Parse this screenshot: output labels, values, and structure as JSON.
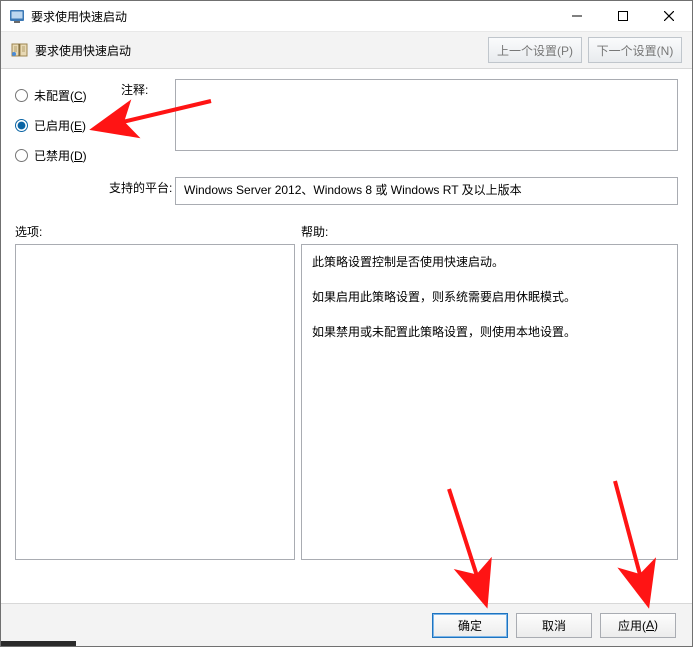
{
  "window": {
    "title": "要求使用快速启动"
  },
  "toolbar": {
    "subtitle": "要求使用快速启动",
    "prev_label": "上一个设置(P)",
    "next_label": "下一个设置(N)"
  },
  "config": {
    "radios": {
      "not_configured": {
        "label": "未配置(",
        "key": "C",
        "tail": ")"
      },
      "enabled": {
        "label": "已启用(",
        "key": "E",
        "tail": ")"
      },
      "disabled": {
        "label": "已禁用(",
        "key": "D",
        "tail": ")"
      }
    },
    "selected": "enabled",
    "comment_label": "注释:",
    "comment_value": "",
    "platform_label": "支持的平台:",
    "platform_value": "Windows Server 2012、Windows 8 或 Windows RT 及以上版本"
  },
  "sections": {
    "options_label": "选项:",
    "help_label": "帮助:"
  },
  "help": {
    "p1": "此策略设置控制是否使用快速启动。",
    "p2": "如果启用此策略设置，则系统需要启用休眠模式。",
    "p3": "如果禁用或未配置此策略设置，则使用本地设置。"
  },
  "footer": {
    "ok": "确定",
    "cancel": "取消",
    "apply_label": "应用(",
    "apply_key": "A",
    "apply_tail": ")"
  },
  "icons": {
    "app": "app-icon",
    "minimize": "minimize-icon",
    "maximize": "maximize-icon",
    "close": "close-icon"
  }
}
